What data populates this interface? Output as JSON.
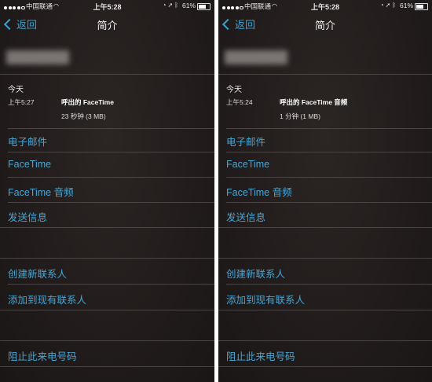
{
  "left": {
    "status_bar": {
      "carrier": "中国联通",
      "time": "上午5:28",
      "battery": "61%"
    },
    "nav": {
      "back": "返回",
      "title": "简介"
    },
    "recents": {
      "heading": "今天",
      "time": "上午5:27",
      "type": "呼出的 FaceTime",
      "detail": "23 秒钟 (3 MB)"
    },
    "actions": [
      "电子邮件",
      "FaceTime",
      "FaceTime 音频",
      "发送信息"
    ],
    "contact_actions": [
      "创建新联系人",
      "添加到现有联系人"
    ],
    "block": "阻止此来电号码"
  },
  "right": {
    "status_bar": {
      "carrier": "中国联通",
      "time": "上午5:28",
      "battery": "61%"
    },
    "nav": {
      "back": "返回",
      "title": "简介"
    },
    "recents": {
      "heading": "今天",
      "time": "上午5:24",
      "type": "呼出的 FaceTime 音频",
      "detail": "1 分钟 (1 MB)"
    },
    "actions": [
      "电子邮件",
      "FaceTime",
      "FaceTime 音频",
      "发送信息"
    ],
    "contact_actions": [
      "创建新联系人",
      "添加到现有联系人"
    ],
    "block": "阻止此来电号码"
  },
  "status_icons": {
    "signal": "signal-dots-icon",
    "wifi": "wifi-icon",
    "lock": "lock-rotation-icon",
    "location": "location-icon",
    "bluetooth": "bluetooth-icon",
    "battery": "battery-icon"
  },
  "battery_level": 0.61,
  "colors": {
    "accent": "#46a6d6",
    "background": "#221d1c",
    "separator": "#4a4442"
  }
}
